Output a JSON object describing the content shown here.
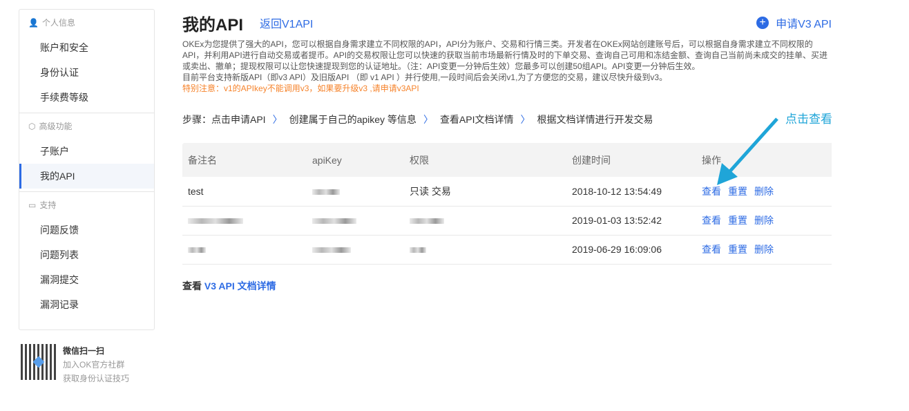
{
  "sidebar": {
    "groups": [
      {
        "title": "个人信息",
        "icon": "user-icon",
        "items": [
          "账户和安全",
          "身份认证",
          "手续费等级"
        ]
      },
      {
        "title": "高级功能",
        "icon": "cube-icon",
        "items": [
          "子账户",
          "我的API"
        ]
      },
      {
        "title": "支持",
        "icon": "chat-icon",
        "items": [
          "问题反馈",
          "问题列表",
          "漏洞提交",
          "漏洞记录"
        ]
      }
    ],
    "active": "我的API",
    "qr": {
      "title": "微信扫一扫",
      "line1": "加入OK官方社群",
      "line2": "获取身份认证技巧"
    }
  },
  "header": {
    "title": "我的API",
    "back_link": "返回V1API",
    "apply_button": "申请V3 API"
  },
  "description": {
    "p1": "OKEx为您提供了强大的API，您可以根据自身需求建立不同权限的API，API分为账户、交易和行情三类。开发者在OKEx网站创建账号后，可以根据自身需求建立不同权限的API，并利用API进行自动交易或者提币。API的交易权限让您可以快速的获取当前市场最新行情及时的下单交易、查询自己可用和冻结金额、查询自己当前尚未成交的挂单、买进或卖出、撤单；提现权限可以让您快速提现到您的认证地址。（注：API变更一分钟后生效）您最多可以创建50组API。API变更一分钟后生效。",
    "p2": "目前平台支持新版API（即v3 API）及旧版API （即 v1 API ）并行使用,一段时间后会关闭v1,为了方便您的交易，建议尽快升级到v3。",
    "warning": "特别注意：v1的APIkey不能调用v3，如果要升级v3 ,请申请v3API"
  },
  "steps": [
    "步骤：点击申请API",
    "创建属于自己的apikey 等信息",
    "查看API文档详情",
    "根据文档详情进行开发交易"
  ],
  "table": {
    "headers": [
      "备注名",
      "apiKey",
      "权限",
      "创建时间",
      "操作"
    ],
    "rows": [
      {
        "name": "test",
        "perm": "只读 交易",
        "time": "2018-10-12 13:54:49"
      },
      {
        "name": "",
        "perm": "",
        "time": "2019-01-03 13:52:42"
      },
      {
        "name": "",
        "perm": "",
        "time": "2019-06-29 16:09:06"
      }
    ],
    "actions": [
      "查看",
      "重置",
      "删除"
    ]
  },
  "doc": {
    "prefix": "查看",
    "link": "V3 API 文档详情"
  },
  "annotation": "点击查看"
}
